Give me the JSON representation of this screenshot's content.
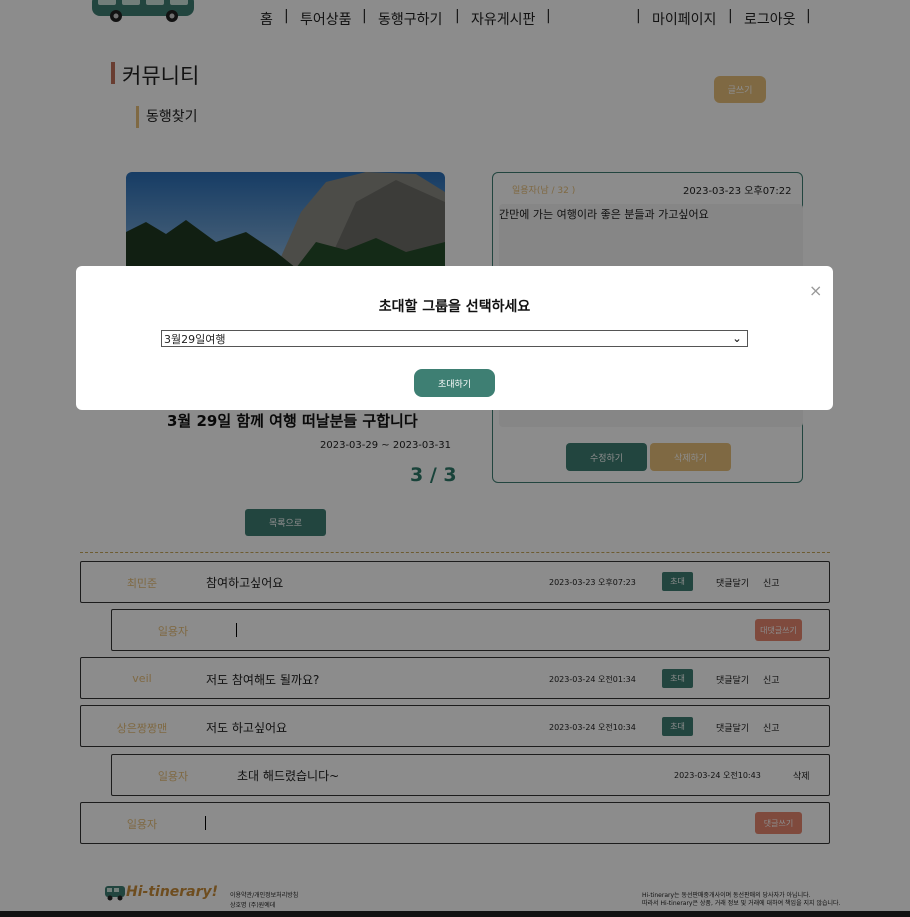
{
  "nav": {
    "items": [
      "홈",
      "투어상품",
      "동행구하기",
      "자유게시판",
      "마이페이지",
      "로그아웃"
    ]
  },
  "section": {
    "title": "커뮤니티",
    "subtitle": "동행찾기",
    "write_button": "글쓰기"
  },
  "post": {
    "title": "3월 29일 함께 여행 떠날분들 구합니다",
    "dates": "2023-03-29 ~ 2023-03-31",
    "count": "3 / 3",
    "list_button": "목록으로"
  },
  "detail": {
    "author": "일용자(남 / 32 )",
    "date": "2023-03-23 오후07:22",
    "content": "간만에 가는 여행이라 좋은 분들과 가고싶어요",
    "edit_button": "수정하기",
    "delete_button": "삭제하기"
  },
  "comments": [
    {
      "author": "최민준",
      "text": "참여하고싶어요",
      "date": "2023-03-23 오후07:23",
      "invite": "초대",
      "reply": "댓글달기",
      "report": "신고"
    },
    {
      "author": "veil",
      "text": "저도 참여해도 될까요?",
      "date": "2023-03-24 오전01:34",
      "invite": "초대",
      "reply": "댓글달기",
      "report": "신고"
    },
    {
      "author": "상은짱짱맨",
      "text": "저도 하고싶어요",
      "date": "2023-03-24 오전10:34",
      "invite": "초대",
      "reply": "댓글달기",
      "report": "신고"
    }
  ],
  "reply_input": {
    "author": "일용자",
    "button": "대댓글쓰기"
  },
  "reply": {
    "author": "일용자",
    "text": "초대 해드렸습니다~",
    "date": "2023-03-24 오전10:43",
    "delete": "삭제"
  },
  "comment_input": {
    "author": "일용자",
    "button": "댓글쓰기"
  },
  "footer": {
    "logo": "Hi-tinerary!",
    "links": "이용약관/개인정보처리방침",
    "company": "상호명 (주)원예데",
    "notice1": "Hi-tinerary는 동선판매중개사이며 동선판매의 당사자가 아닙니다.",
    "notice2": "따라서 Hi-tinerary은 상품, 거래 정보 및 거래에 대하여 책임을 지지 않습니다."
  },
  "modal": {
    "title": "초대할 그룹을 선택하세요",
    "selected_group": "3월29일여행",
    "confirm_button": "초대하기",
    "close_glyph": "×"
  },
  "colors": {
    "accent": "#3e7f73",
    "gold": "#e8c07a",
    "coral": "#e88870",
    "bar": "#c0705a"
  }
}
